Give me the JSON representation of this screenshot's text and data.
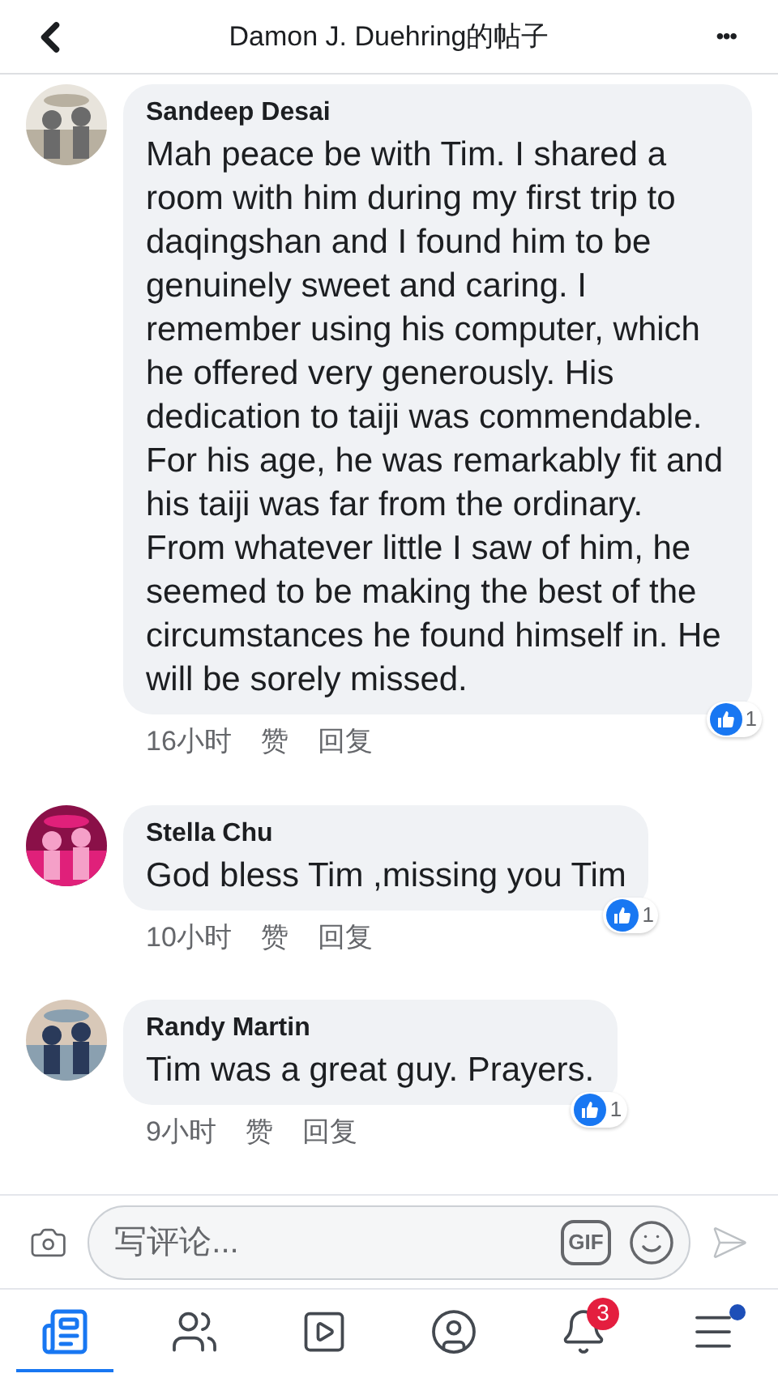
{
  "header": {
    "title": "Damon J. Duehring的帖子",
    "more": "•••"
  },
  "comments": [
    {
      "name": "Sandeep Desai",
      "text": "Mah peace be with Tim. I shared a room with him during my first trip to daqingshan and I found him to be genuinely sweet and caring. I remember using his computer, which he offered very generously. His dedication to taiji was commendable. For his age, he was remarkably fit and his taiji was far from the ordinary. From whatever little I saw of him, he seemed to be making the best of the circumstances he found himself in. He will be sorely missed.",
      "time": "16小时",
      "like": "赞",
      "reply": "回复",
      "reactions": "1"
    },
    {
      "name": "Stella Chu",
      "text": "God bless Tim ,missing you Tim",
      "time": "10小时",
      "like": "赞",
      "reply": "回复",
      "reactions": "1"
    },
    {
      "name": "Randy Martin",
      "text": "Tim was a great guy. Prayers.",
      "time": "9小时",
      "like": "赞",
      "reply": "回复",
      "reactions": "1"
    }
  ],
  "composer": {
    "placeholder": "写评论...",
    "gif": "GIF"
  },
  "tabs": [
    {
      "kind": "news",
      "selected": true
    },
    {
      "kind": "friends",
      "selected": false
    },
    {
      "kind": "video",
      "selected": false
    },
    {
      "kind": "profile",
      "selected": false
    },
    {
      "kind": "notifications",
      "selected": false,
      "badge": "3"
    },
    {
      "kind": "menu",
      "selected": false,
      "dot": true
    }
  ]
}
